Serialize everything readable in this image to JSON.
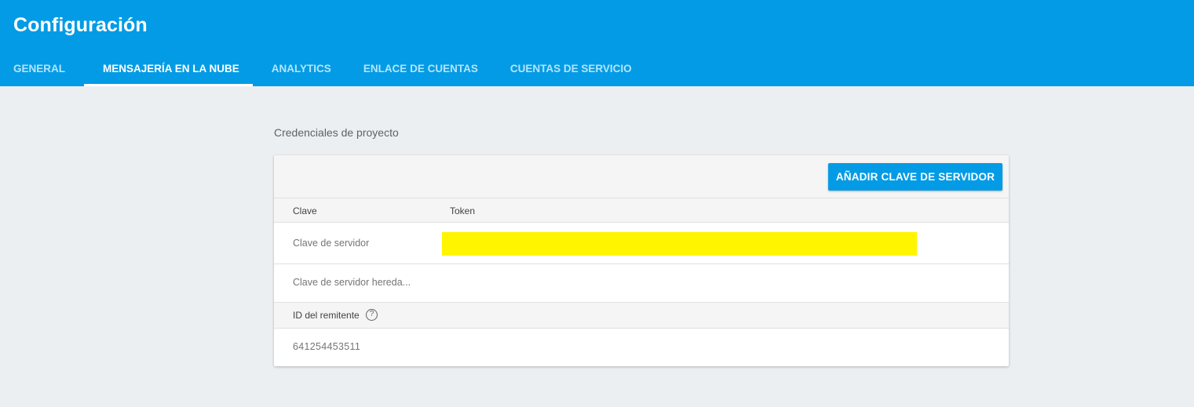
{
  "header": {
    "title": "Configuración",
    "tabs": [
      {
        "label": "GENERAL"
      },
      {
        "label": "MENSAJERÍA EN LA NUBE"
      },
      {
        "label": "ANALYTICS"
      },
      {
        "label": "ENLACE DE CUENTAS"
      },
      {
        "label": "CUENTAS DE SERVICIO"
      }
    ],
    "active_tab": "MENSAJERÍA EN LA NUBE",
    "background_color": "#039be5"
  },
  "credentials": {
    "section_title": "Credenciales de proyecto",
    "add_button_label": "AÑADIR CLAVE DE SERVIDOR",
    "columns": {
      "key": "Clave",
      "token": "Token"
    },
    "rows": [
      {
        "key": "Clave de servidor",
        "token_redacted": true,
        "redaction_color": "#fff500"
      },
      {
        "key": "Clave de servidor hereda..."
      }
    ],
    "sender_id_label": "ID del remitente",
    "sender_id_help_icon": "help-circle-icon",
    "sender_id_value": "641254453511"
  }
}
